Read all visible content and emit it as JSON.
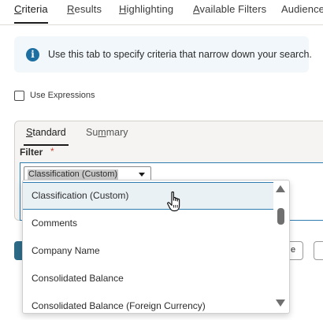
{
  "tabs": [
    {
      "pre": "",
      "u": "C",
      "post": "riteria"
    },
    {
      "pre": "",
      "u": "R",
      "post": "esults"
    },
    {
      "pre": "",
      "u": "H",
      "post": "ighlighting"
    },
    {
      "pre": "",
      "u": "A",
      "post": "vailable Filters"
    },
    {
      "pre": "Audience",
      "u": "",
      "post": ""
    }
  ],
  "info": {
    "icon": "info-icon",
    "text": "Use this tab to specify criteria that narrow down your search."
  },
  "use_expressions": {
    "label": "Use Expressions",
    "checked": false
  },
  "subtabs": [
    {
      "pre": "",
      "u": "S",
      "post": "tandard"
    },
    {
      "pre": "Su",
      "u": "m",
      "post": "mary"
    }
  ],
  "filter": {
    "label": "Filter",
    "required_mark": "*",
    "selected_value": "Classification (Custom)"
  },
  "buttons": {
    "partial_label": "e"
  },
  "dropdown": {
    "options": [
      "Classification (Custom)",
      "Comments",
      "Company Name",
      "Consolidated Balance",
      "Consolidated Balance (Foreign Currency)"
    ]
  },
  "colors": {
    "accent": "#2f7cb0",
    "info_icon": "#1d6fa2",
    "required": "#c74634",
    "primary_button": "#2d6a87"
  }
}
